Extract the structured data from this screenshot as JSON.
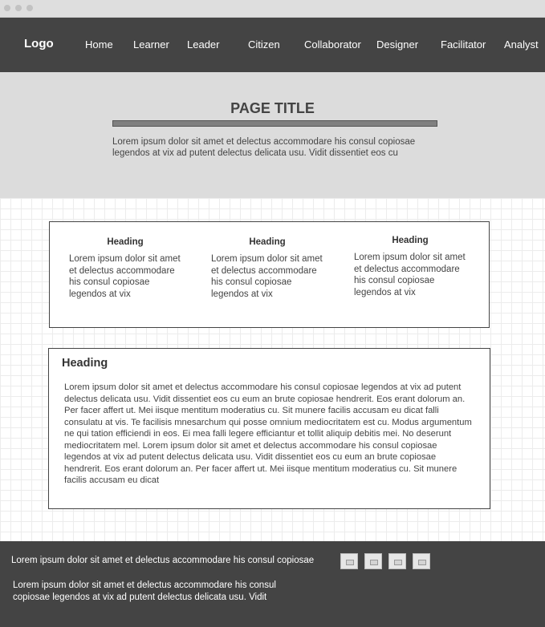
{
  "nav": {
    "logo": "Logo",
    "items": [
      "Home",
      "Learner",
      "Leader",
      "Citizen",
      "Collaborator",
      "Designer",
      "Facilitator",
      "Analyst"
    ]
  },
  "hero": {
    "title": "PAGE TITLE",
    "text": "Lorem ipsum dolor sit amet et delectus accommodare his consul copiosae legendos at vix ad putent delectus delicata usu. Vidit dissentiet eos cu"
  },
  "columns": [
    {
      "heading": "Heading",
      "text": "Lorem ipsum dolor sit amet et delectus accommodare his consul copiosae legendos at vix"
    },
    {
      "heading": "Heading",
      "text": "Lorem ipsum dolor sit amet et delectus accommodare his consul copiosae legendos at vix"
    },
    {
      "heading": "Heading",
      "text": "Lorem ipsum dolor sit amet et delectus accommodare his consul copiosae legendos at vix"
    }
  ],
  "article": {
    "heading": "Heading",
    "text": "Lorem ipsum dolor sit amet et delectus accommodare his consul copiosae legendos at vix ad putent delectus delicata usu. Vidit dissentiet eos cu eum an brute copiosae hendrerit. Eos erant dolorum an. Per facer affert ut. Mei iisque mentitum moderatius cu. Sit munere facilis accusam eu dicat falli consulatu at vis. Te facilisis mnesarchum qui posse omnium mediocritatem est cu. Modus argumentum ne qui tation efficiendi in eos. Ei mea falli legere efficiantur et tollit aliquip debitis mei. No deserunt mediocritatem mel. Lorem ipsum dolor sit amet et delectus accommodare his consul copiosae legendos at vix ad putent delectus delicata usu. Vidit dissentiet eos cu eum an brute copiosae hendrerit. Eos erant dolorum an. Per facer affert ut. Mei iisque mentitum moderatius cu. Sit munere facilis accusam eu dicat"
  },
  "footer": {
    "line1": "Lorem ipsum dolor sit amet et delectus accommodare his consul copiosae",
    "line2": "Lorem ipsum dolor sit amet et delectus accommodare his consul copiosae legendos at vix ad putent delectus delicata usu. Vidit",
    "social_icons": [
      "image-icon",
      "image-icon",
      "image-icon",
      "image-icon"
    ]
  }
}
